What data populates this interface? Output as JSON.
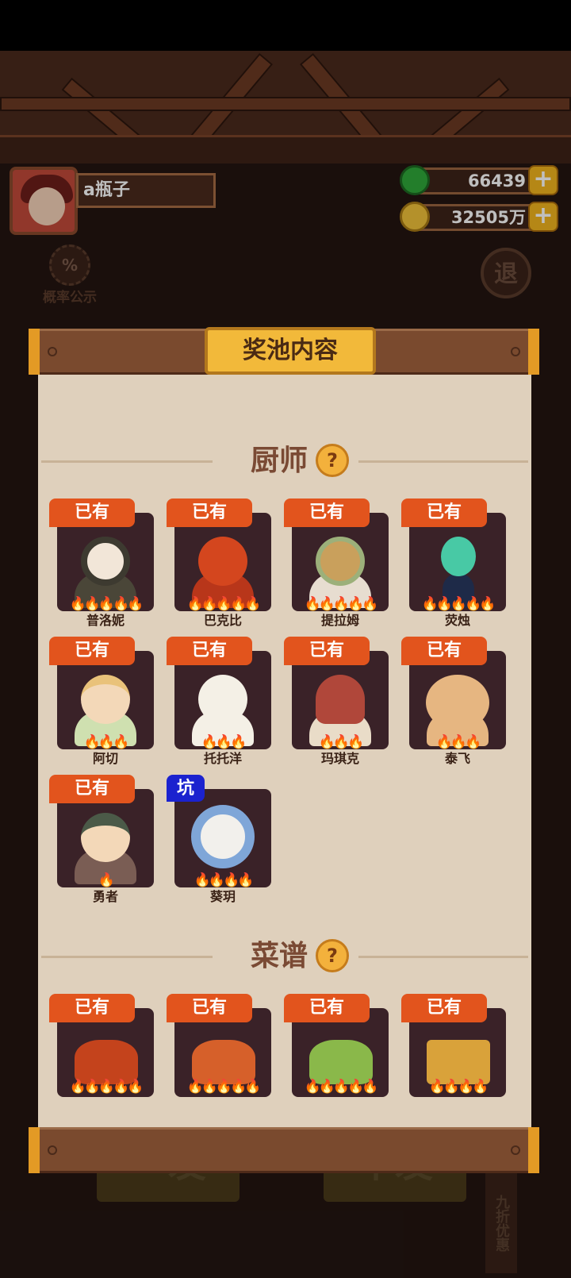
{
  "player": {
    "name": "a瓶子"
  },
  "resources": [
    {
      "icon": "jade-icon",
      "value": "66439",
      "plus": "+"
    },
    {
      "icon": "coin-icon",
      "value": "32505万",
      "plus": "+"
    }
  ],
  "left_button": {
    "icon": "percent-gear-icon",
    "icon_glyph": "%",
    "label": "概率公示"
  },
  "exit_button": {
    "label": "退"
  },
  "panel": {
    "title": "奖池内容"
  },
  "sections": [
    {
      "label": "厨师",
      "help": "?"
    },
    {
      "label": "菜谱",
      "help": "?"
    }
  ],
  "chefs": [
    {
      "name": "普洛妮",
      "badge": "已有",
      "flames": "🔥🔥🔥🔥🔥",
      "color": "#8a7a64"
    },
    {
      "name": "巴克比",
      "badge": "已有",
      "flames": "🔥🔥🔥🔥🔥",
      "color": "#d4461e"
    },
    {
      "name": "提拉姆",
      "badge": "已有",
      "flames": "🔥🔥🔥🔥🔥",
      "color": "#c9a05c"
    },
    {
      "name": "荧烛",
      "badge": "已有",
      "flames": "🔥🔥🔥🔥🔥",
      "color": "#48c9a5"
    },
    {
      "name": "阿切",
      "badge": "已有",
      "flames": "🔥🔥🔥",
      "color": "#e9c27a"
    },
    {
      "name": "托托洋",
      "badge": "已有",
      "flames": "🔥🔥🔥",
      "color": "#f4f0e6"
    },
    {
      "name": "玛琪克",
      "badge": "已有",
      "flames": "🔥🔥🔥",
      "color": "#b0473a"
    },
    {
      "name": "泰飞",
      "badge": "已有",
      "flames": "🔥🔥🔥",
      "color": "#e6b681"
    },
    {
      "name": "勇者",
      "badge": "已有",
      "flames": "🔥",
      "color": "#4b5a48"
    },
    {
      "name": "葵玥",
      "badge": "坑",
      "flames": "🔥🔥🔥🔥",
      "color": "#7fa6d8"
    }
  ],
  "recipes": [
    {
      "badge": "已有",
      "flames": "🔥🔥🔥🔥🔥",
      "color": "#c4431c"
    },
    {
      "badge": "已有",
      "flames": "🔥🔥🔥🔥🔥",
      "color": "#d6602a"
    },
    {
      "badge": "已有",
      "flames": "🔥🔥🔥🔥🔥",
      "color": "#8ab84a"
    },
    {
      "badge": "已有",
      "flames": "🔥🔥🔥🔥",
      "color": "#d9a23a"
    }
  ],
  "bottom": {
    "single": "一发",
    "ten": "十发",
    "discount": "九折优惠"
  }
}
